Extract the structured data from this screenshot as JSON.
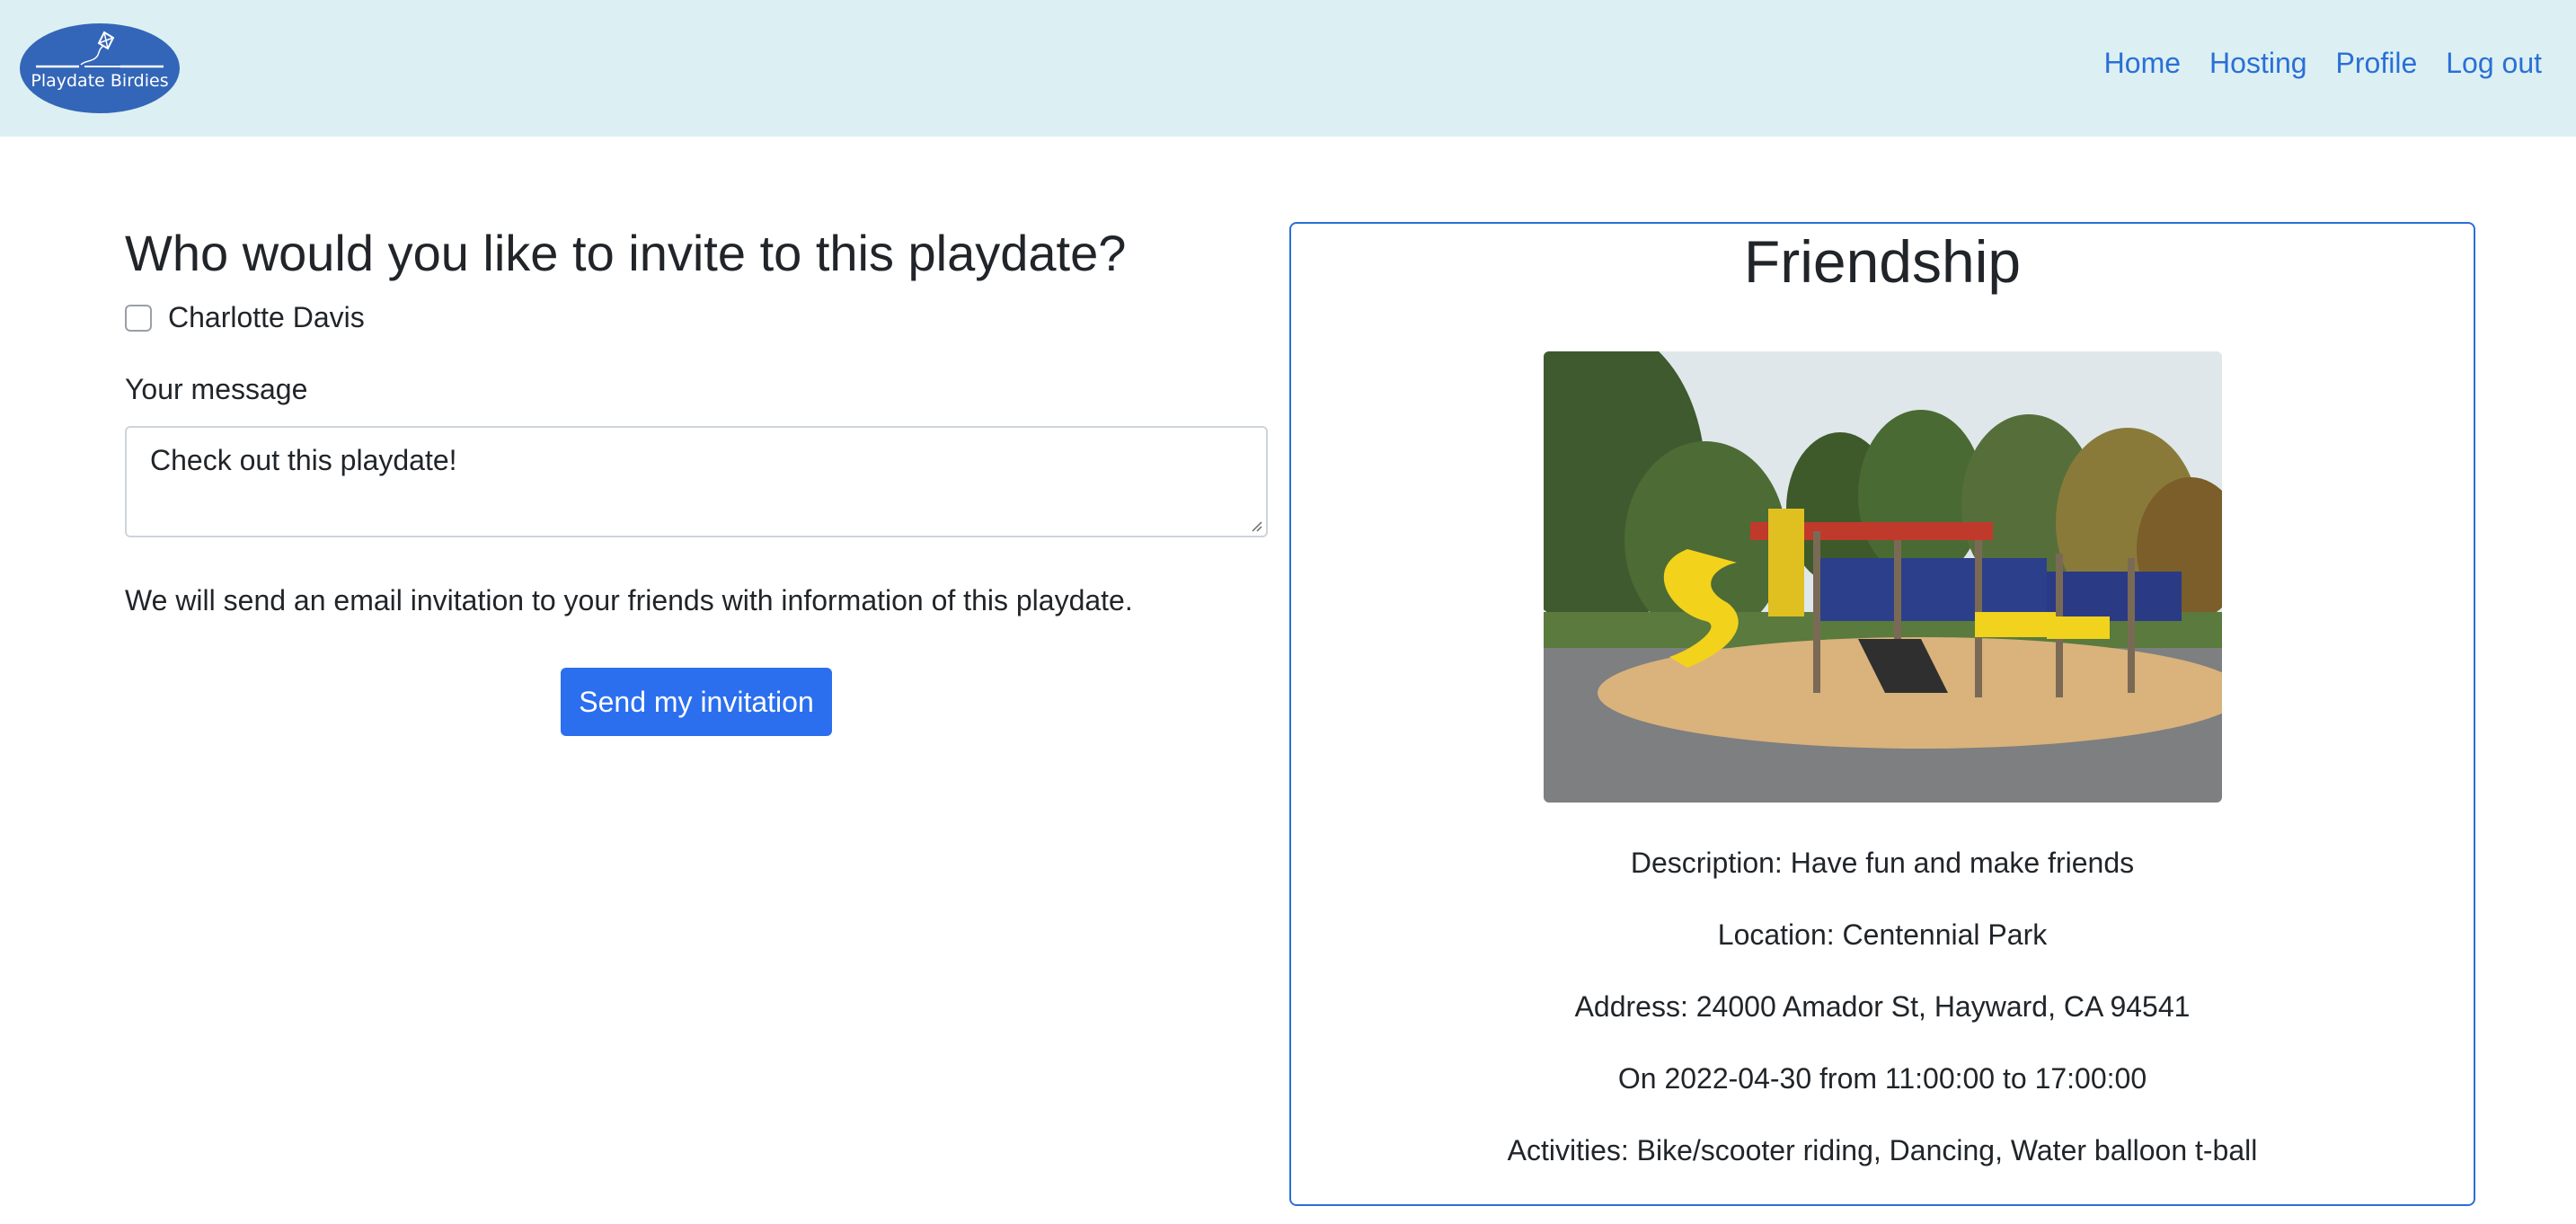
{
  "navbar": {
    "logo_text": "Playdate Birdies",
    "links": [
      "Home",
      "Hosting",
      "Profile",
      "Log out"
    ]
  },
  "invite": {
    "title": "Who would you like to invite to this playdate?",
    "friends": [
      {
        "name": "Charlotte Davis",
        "checked": false
      }
    ],
    "message_label": "Your message",
    "message_value": "Check out this playdate!",
    "info": "We will send an email invitation to your friends with information of this playdate.",
    "send_label": "Send my invitation"
  },
  "playdate": {
    "title": "Friendship",
    "description": "Description: Have fun and make friends",
    "location": "Location: Centennial Park",
    "address": "Address: 24000 Amador St, Hayward, CA 94541",
    "datetime": "On 2022-04-30 from 11:00:00 to 17:00:00",
    "activities": "Activities: Bike/scooter riding, Dancing, Water balloon t-ball",
    "image_subject": "playground-photo"
  },
  "colors": {
    "navbar_bg": "#dcf0f3",
    "logo_bg": "#3366b8",
    "link": "#2b6fd6",
    "primary_button": "#2b6fef",
    "card_border": "#2b6fd6"
  }
}
